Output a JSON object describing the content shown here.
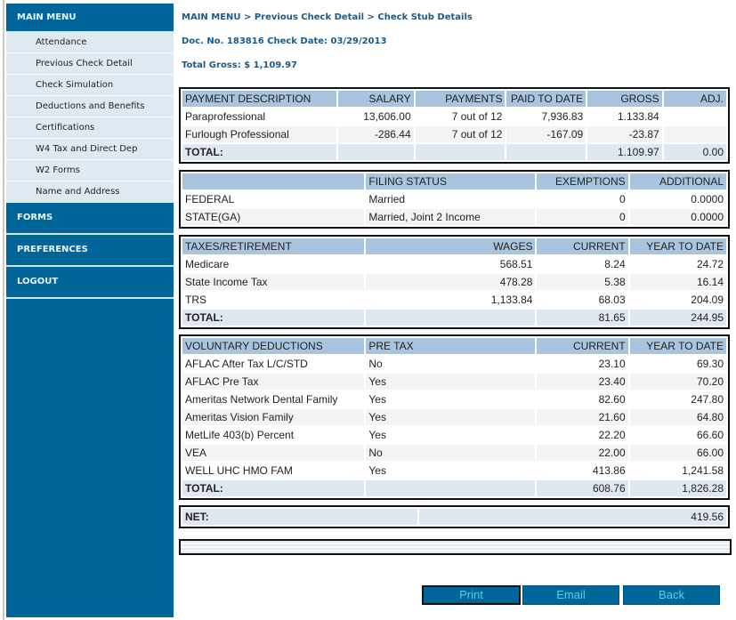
{
  "sidebar": {
    "main_menu": "MAIN MENU",
    "items": [
      {
        "label": "Attendance"
      },
      {
        "label": "Previous Check Detail"
      },
      {
        "label": "Check Simulation"
      },
      {
        "label": "Deductions and Benefits"
      },
      {
        "label": "Certifications"
      },
      {
        "label": "W4 Tax and Direct Dep"
      },
      {
        "label": "W2 Forms"
      },
      {
        "label": "Name and Address"
      }
    ],
    "sections": [
      {
        "label": "FORMS"
      },
      {
        "label": "PREFERENCES"
      },
      {
        "label": "LOGOUT"
      }
    ],
    "color": "#006699"
  },
  "header": {
    "breadcrumb": "MAIN MENU > Previous Check Detail > Check Stub Details",
    "doc_line": "Doc. No. 183816 Check Date: 03/29/2013",
    "total_gross": "Total Gross: $ 1,109.97"
  },
  "payments": {
    "headers": [
      "PAYMENT DESCRIPTION",
      "SALARY",
      "PAYMENTS",
      "PAID TO DATE",
      "GROSS",
      "ADJ."
    ],
    "rows": [
      [
        "Paraprofessional",
        "13,606.00",
        "7 out of 12",
        "7,936.83",
        "1.133.84",
        ""
      ],
      [
        "Furlough Professional",
        "-286.44",
        "7 out of 12",
        "-167.09",
        "-23.87",
        ""
      ]
    ],
    "total_label": "TOTAL:",
    "total_gross": "1.109.97",
    "total_adj": "0.00"
  },
  "filing": {
    "headers": [
      "",
      "FILING STATUS",
      "EXEMPTIONS",
      "ADDITIONAL"
    ],
    "rows": [
      [
        "FEDERAL",
        "Married",
        "0",
        "0.0000"
      ],
      [
        "STATE(GA)",
        "Married, Joint 2 Income",
        "0",
        "0.0000"
      ]
    ]
  },
  "taxes": {
    "headers": [
      "TAXES/RETIREMENT",
      "WAGES",
      "CURRENT",
      "YEAR TO DATE"
    ],
    "rows": [
      [
        "Medicare",
        "568.51",
        "8.24",
        "24.72"
      ],
      [
        "State Income Tax",
        "478.28",
        "5.38",
        "16.14"
      ],
      [
        "TRS",
        "1,133.84",
        "68.03",
        "204.09"
      ]
    ],
    "total_label": "TOTAL:",
    "total_current": "81.65",
    "total_ytd": "244.95"
  },
  "voluntary": {
    "headers": [
      "VOLUNTARY DEDUCTIONS",
      "PRE TAX",
      "CURRENT",
      "YEAR TO DATE"
    ],
    "rows": [
      [
        "AFLAC After Tax L/C/STD",
        "No",
        "23.10",
        "69.30"
      ],
      [
        "AFLAC Pre Tax",
        "Yes",
        "23.40",
        "70.20"
      ],
      [
        "Ameritas Network Dental Family",
        "Yes",
        "82.60",
        "247.80"
      ],
      [
        "Ameritas Vision Family",
        "Yes",
        "21.60",
        "64.80"
      ],
      [
        "MetLife 403(b) Percent",
        "Yes",
        "22.20",
        "66.60"
      ],
      [
        "VEA",
        "No",
        "22.00",
        "66.00"
      ],
      [
        "WELL UHC HMO FAM",
        "Yes",
        "413.86",
        "1,241.58"
      ]
    ],
    "total_label": "TOTAL:",
    "total_current": "608.76",
    "total_ytd": "1,826.28"
  },
  "net": {
    "label": "NET:",
    "value": "419.56"
  },
  "buttons": {
    "print": "Print",
    "email": "Email",
    "back": "Back"
  }
}
